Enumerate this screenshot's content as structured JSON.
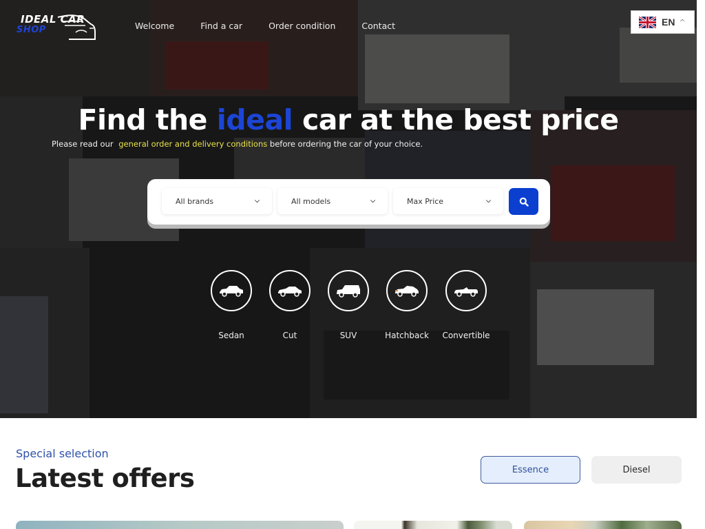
{
  "brand": {
    "line1": "IDEAL CAR",
    "line2": "SHOP",
    "logo_icon": "car-outline-icon"
  },
  "nav": {
    "items": [
      {
        "label": "Welcome"
      },
      {
        "label": "Find a car"
      },
      {
        "label": "Order condition"
      },
      {
        "label": "Contact"
      }
    ]
  },
  "language": {
    "code": "EN",
    "flag_icon": "uk-flag-icon",
    "caret_icon": "chevron-up-icon",
    "caret": "^"
  },
  "hero": {
    "headline_before": "Find the ",
    "headline_accent": "ideal",
    "headline_after": " car at the best price",
    "sub_before": "Please read our ",
    "sub_link": "general order and delivery conditions",
    "sub_after": " before ordering the car of your choice."
  },
  "search": {
    "brand_select": "All brands",
    "model_select": "All models",
    "price_select": "Max Price",
    "chevron": "⌄",
    "button_icon": "search-icon"
  },
  "categories": [
    {
      "label": "Sedan",
      "icon": "sedan-icon"
    },
    {
      "label": "Cut",
      "icon": "coupe-icon"
    },
    {
      "label": "SUV",
      "icon": "suv-icon"
    },
    {
      "label": "Hatchback",
      "icon": "hatchback-icon"
    },
    {
      "label": "Convertible",
      "icon": "convertible-icon"
    }
  ],
  "offers": {
    "kicker": "Special selection",
    "title": "Latest offers",
    "filters": [
      {
        "label": "Essence",
        "active": true
      },
      {
        "label": "Diesel",
        "active": false
      }
    ]
  },
  "colors": {
    "accent_blue": "#1c45d6",
    "button_blue": "#0a3fcf",
    "link_yellow": "#e8e24a",
    "kicker_blue": "#2d52a8"
  }
}
